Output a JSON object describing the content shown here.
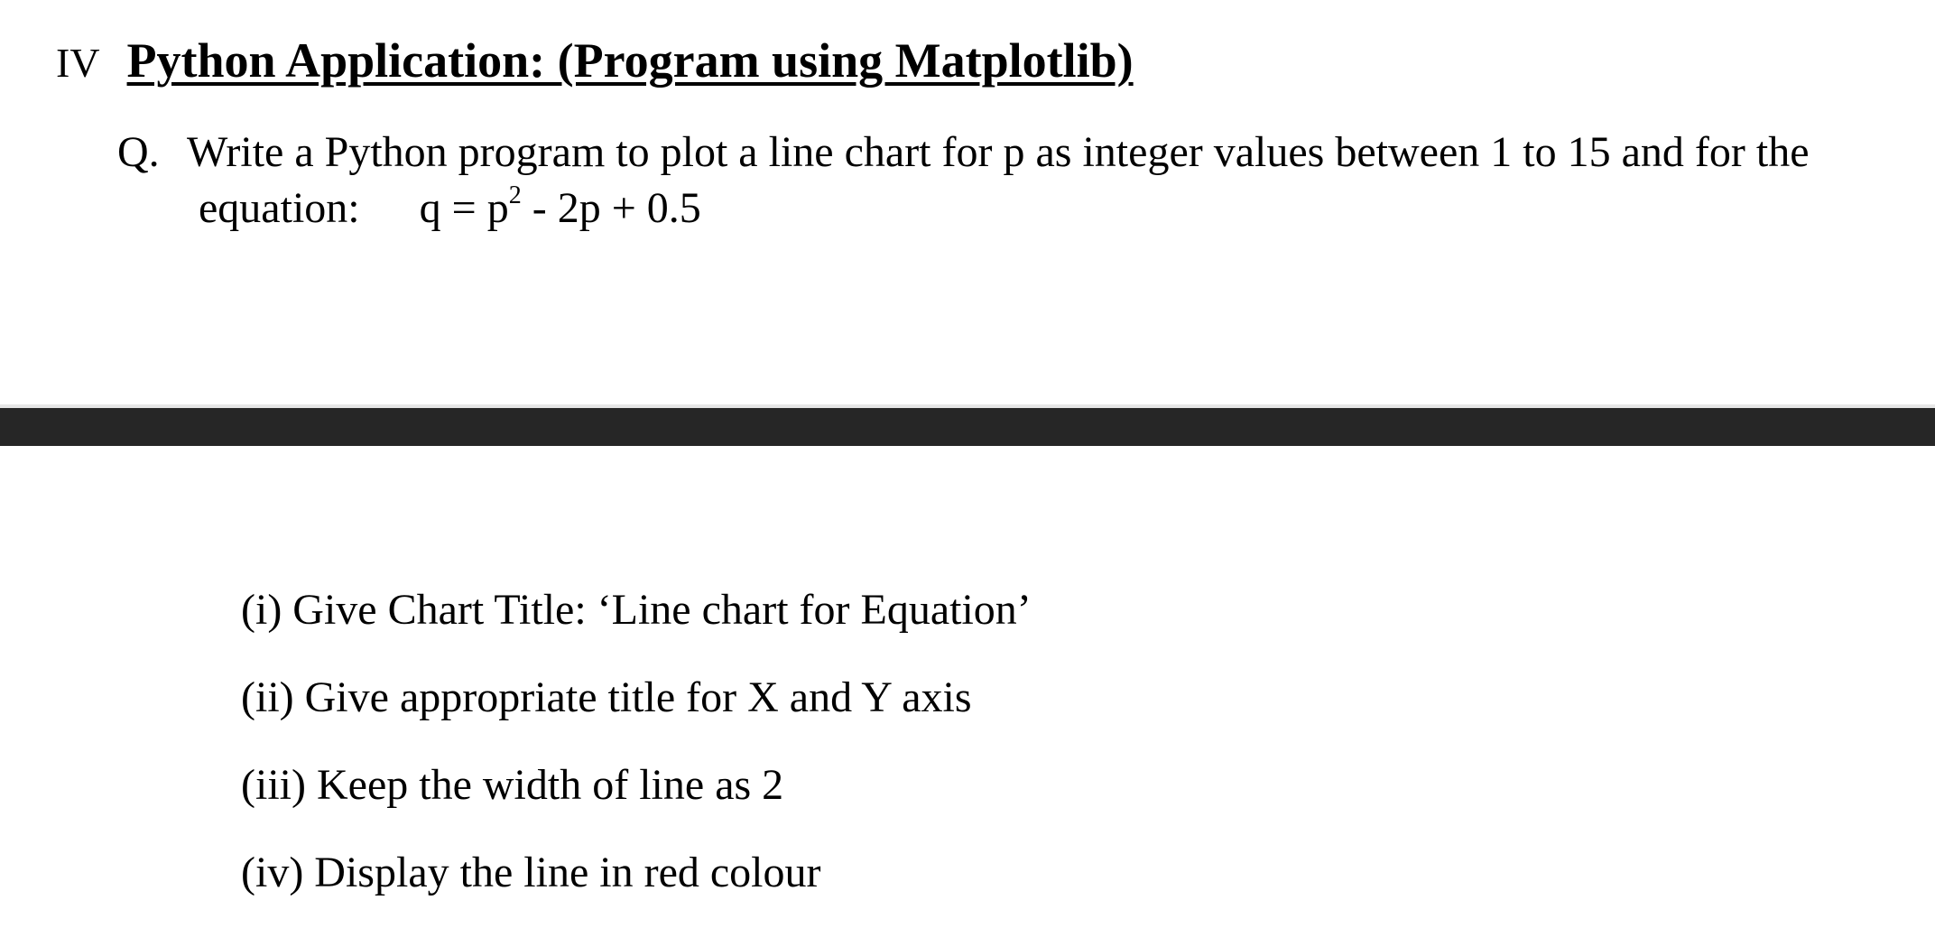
{
  "section": {
    "number": "IV",
    "title": "Python Application: (Program using Matplotlib)"
  },
  "question": {
    "label": "Q.",
    "text_line1": "Write a Python program to plot a line chart for p as integer values between 1 to 15 and for the",
    "equation_label": "equation:",
    "equation_lhs": "q = p",
    "equation_exponent": "2",
    "equation_rhs": " - 2p + 0.5"
  },
  "requirements": [
    "(i) Give Chart Title: ‘Line chart for Equation’",
    "(ii) Give appropriate title for X and Y axis",
    "(iii) Keep the width of line as 2",
    "(iv) Display the line in red colour"
  ],
  "colors": {
    "text": "#000000",
    "divider": "#262626",
    "background": "#ffffff"
  }
}
